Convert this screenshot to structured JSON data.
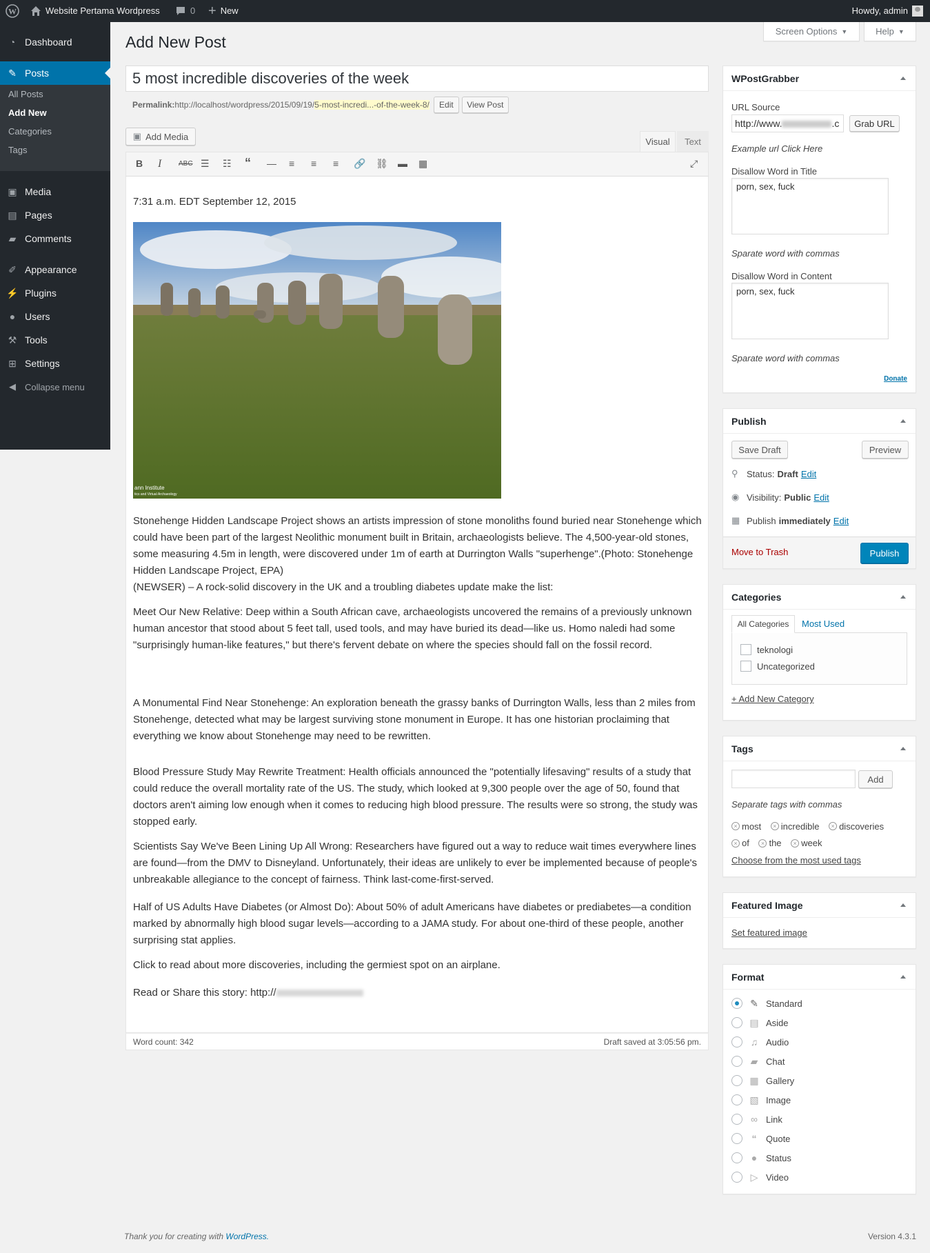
{
  "adminbar": {
    "site": "Website Pertama Wordpress",
    "comments": "0",
    "new": "New",
    "howdy": "Howdy, admin"
  },
  "sidebar": {
    "items": [
      {
        "label": "Dashboard",
        "icon": "dashboard-icon"
      },
      {
        "label": "Posts",
        "icon": "pushpin-icon"
      },
      {
        "label": "Media",
        "icon": "media-icon"
      },
      {
        "label": "Pages",
        "icon": "pages-icon"
      },
      {
        "label": "Comments",
        "icon": "comment-icon"
      },
      {
        "label": "Appearance",
        "icon": "brush-icon"
      },
      {
        "label": "Plugins",
        "icon": "plugin-icon"
      },
      {
        "label": "Users",
        "icon": "users-icon"
      },
      {
        "label": "Tools",
        "icon": "wrench-icon"
      },
      {
        "label": "Settings",
        "icon": "settings-icon"
      },
      {
        "label": "Collapse menu",
        "icon": "collapse-icon"
      }
    ],
    "submenu": [
      "All Posts",
      "Add New",
      "Categories",
      "Tags"
    ]
  },
  "header": {
    "title": "Add New Post",
    "screen_options": "Screen Options",
    "help": "Help"
  },
  "editor": {
    "post_title": "5 most incredible discoveries of the week",
    "permalink_label": "Permalink:",
    "permalink_base": "http://localhost/wordpress/2015/09/19/",
    "permalink_slug": "5-most-incredi...-of-the-week-8/",
    "edit_btn": "Edit",
    "view_post_btn": "View Post",
    "add_media": "Add Media",
    "tab_visual": "Visual",
    "tab_text": "Text",
    "image_caption": "ann Institute",
    "image_caption2": "tics and Virtual Archaeology",
    "paragraphs": [
      "7:31 a.m. EDT September 12, 2015",
      "Stonehenge Hidden Landscape Project shows an artists impression of stone monoliths found buried near Stonehenge which could have been part of the largest Neolithic monument built in Britain, archaeologists believe. The 4,500-year-old stones, some measuring 4.5m in length, were discovered under 1m of earth at Durrington Walls \"superhenge\".(Photo: Stonehenge Hidden Landscape Project, EPA)",
      "(NEWSER) – A rock-solid discovery in the UK and a troubling diabetes update make the list:",
      "Meet Our New Relative: Deep within a South African cave, archaeologists uncovered the remains of a previously unknown human ancestor that stood about 5 feet tall, used tools, and may have buried its dead—like us. Homo naledi had some \"surprisingly human-like features,\" but there's fervent debate on where the species should fall on the fossil record.",
      "A Monumental Find Near Stonehenge: An exploration beneath the grassy banks of Durrington Walls, less than 2 miles from Stonehenge, detected what may be largest surviving stone monument in Europe. It has one historian proclaiming that everything we know about Stonehenge may need to be rewritten.",
      "Blood Pressure Study May Rewrite Treatment: Health officials announced the \"potentially lifesaving\" results of a study that could reduce the overall mortality rate of the US. The study, which looked at 9,300 people over the age of 50, found that doctors aren't aiming low enough when it comes to reducing high blood pressure. The results were so strong, the study was stopped early.",
      "Scientists Say We've Been Lining Up All Wrong: Researchers have figured out a way to reduce wait times everywhere lines are found—from the DMV to Disneyland. Unfortunately, their ideas are unlikely to ever be implemented because of people's unbreakable allegiance to the concept of fairness. Think last-come-first-served.",
      "Half of US Adults Have Diabetes (or Almost Do): About 50% of adult Americans have diabetes or prediabetes—a condition marked by abnormally high blood sugar levels—according to a JAMA study. For about one-third of these people, another surprising stat applies.",
      "Click to read about more discoveries, including the germiest spot on an airplane.",
      "Read or Share this story: http://"
    ],
    "word_count": "Word count: 342",
    "draft_saved": "Draft saved at 3:05:56 pm."
  },
  "wpostgrabber": {
    "title": "WPostGrabber",
    "url_label": "URL Source",
    "url_value": "http://www.",
    "url_suffix": ".c",
    "grab_btn": "Grab URL",
    "example": "Example url Click Here",
    "disallow_title_label": "Disallow Word in Title",
    "disallow_title_value": "porn, sex, fuck",
    "sep_hint": "Sparate word with commas",
    "disallow_content_label": "Disallow Word in Content",
    "disallow_content_value": "porn, sex, fuck",
    "donate": "Donate"
  },
  "publish": {
    "title": "Publish",
    "save_draft": "Save Draft",
    "preview": "Preview",
    "status_label": "Status:",
    "status_value": "Draft",
    "visibility_label": "Visibility:",
    "visibility_value": "Public",
    "publish_label": "Publish",
    "publish_value": "immediately",
    "edit": "Edit",
    "trash": "Move to Trash",
    "publish_btn": "Publish"
  },
  "categories": {
    "title": "Categories",
    "tab_all": "All Categories",
    "tab_most": "Most Used",
    "items": [
      "teknologi",
      "Uncategorized"
    ],
    "add_new": "+ Add New Category"
  },
  "tags": {
    "title": "Tags",
    "add_btn": "Add",
    "hint": "Separate tags with commas",
    "items": [
      "most",
      "incredible",
      "discoveries",
      "of",
      "the",
      "week"
    ],
    "choose": "Choose from the most used tags"
  },
  "featured": {
    "title": "Featured Image",
    "set": "Set featured image"
  },
  "format": {
    "title": "Format",
    "options": [
      "Standard",
      "Aside",
      "Audio",
      "Chat",
      "Gallery",
      "Image",
      "Link",
      "Quote",
      "Status",
      "Video"
    ],
    "selected": "Standard"
  },
  "footer": {
    "thanks": "Thank you for creating with",
    "wp": "WordPress.",
    "version": "Version 4.3.1"
  },
  "colors": {
    "accent": "#0073aa",
    "adminbar": "#23282d",
    "publish": "#0085ba",
    "trash": "#a00"
  }
}
